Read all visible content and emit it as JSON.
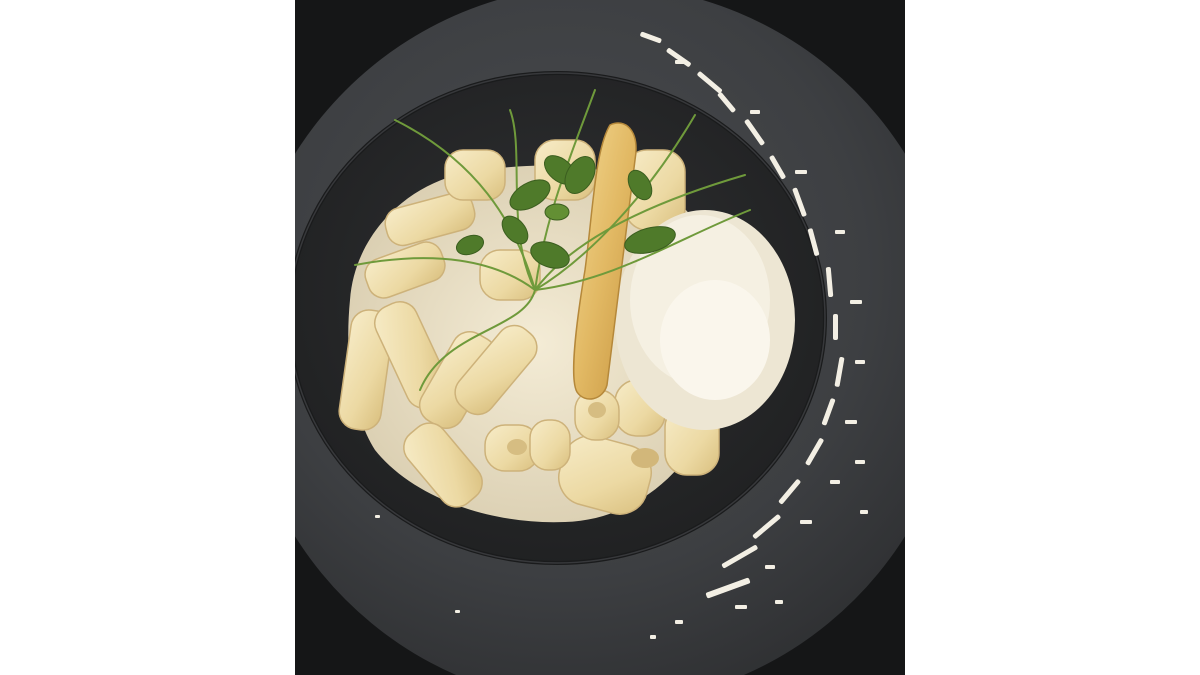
{
  "photo": {
    "subject": "pasta-dish",
    "colors": {
      "background": "#ffffff",
      "plate": "#3c3e40",
      "plate_well": "#2a2b2d",
      "sauce": "#efe7cf",
      "pasta": "#f1e2b0",
      "cheese": "#f5f1e4",
      "microgreens": "#4f7a2a"
    }
  }
}
